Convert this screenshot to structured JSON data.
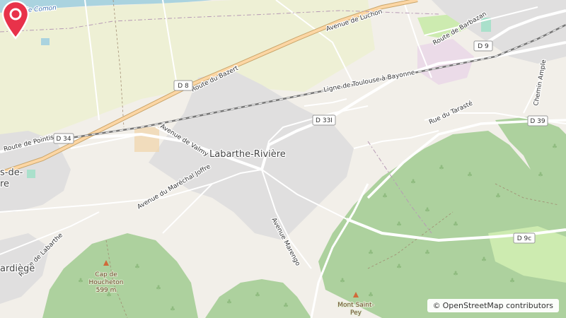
{
  "map": {
    "place_label": "Labarthe-Rivière",
    "attribution": {
      "symbol": "©",
      "text": "OpenStreetMap contributors"
    },
    "streets": {
      "avenue_luchon": "Avenue de Luchon",
      "route_bazert": "Route du Bazert",
      "route_barbazan": "Route de Barbazan",
      "ligne": "Ligne de Toulouse à Bayonne",
      "rue_taraste": "Rue du Tarasté",
      "chemin_ample": "Chemin Ample",
      "route_pointis": "Route de Pointis",
      "avenue_valmy": "Avenue de Valmy",
      "avenue_joffre": "Avenue du Maréchal Joffre",
      "avenue_marengo": "Avenue Marengo",
      "route_labarthe": "Route de Labarthe"
    },
    "water": {
      "canal": "Canal de Comon"
    },
    "route_shields": {
      "d8": "D 8",
      "d9": "D 9",
      "d331": "D 33I",
      "d34": "D 34",
      "d39": "D 39",
      "d9c": "D 9c"
    },
    "villages": {
      "partial_left": "s-de-",
      "partial_left_2": "re",
      "ardiege": "ardiège"
    },
    "peaks": {
      "houcheton_name_1": "Cap de",
      "houcheton_name_2": "Houcheton",
      "houcheton_elev": "599 m",
      "saint_pey_1": "Mont Saint-",
      "saint_pey_2": "Pey"
    },
    "colors": {
      "land": "#f2efe9",
      "farmland": "#eef0d5",
      "forest": "#add19e",
      "residential": "#e0dfdf",
      "water": "#aad3df",
      "primary_road": "#fcd6a4",
      "marker": "#e8324a",
      "industrial": "#ebdbe8"
    }
  }
}
